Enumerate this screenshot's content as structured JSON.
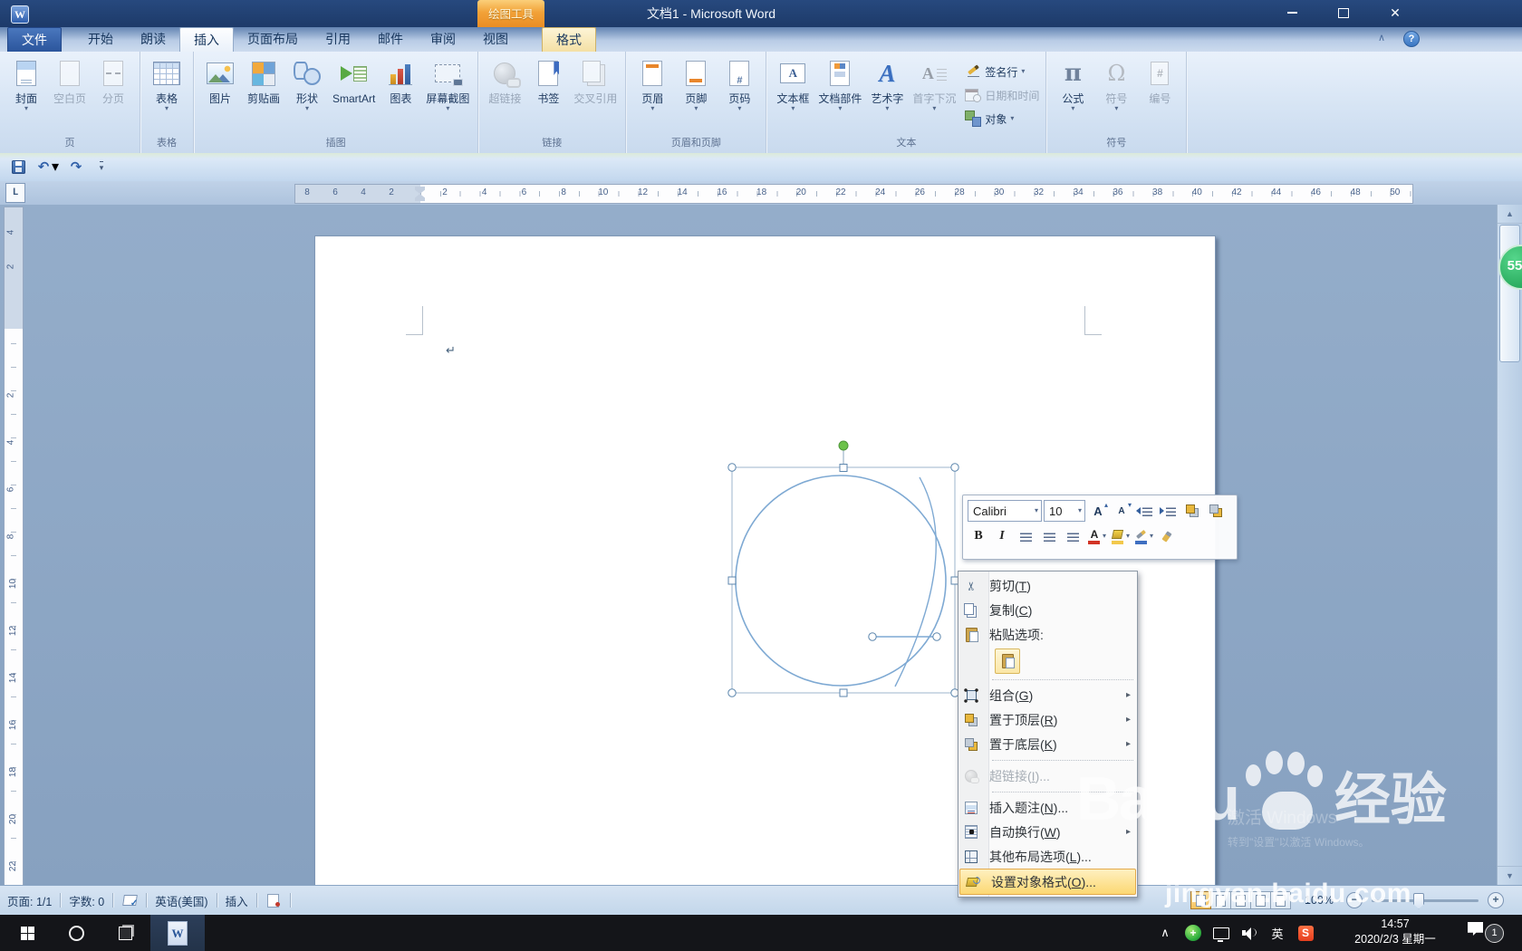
{
  "window": {
    "title": "文档1 - Microsoft Word",
    "app_icon": "W"
  },
  "drawing_tools": {
    "header": "绘图工具",
    "tab": "格式"
  },
  "tabs": [
    {
      "id": "file",
      "label": "文件",
      "type": "file"
    },
    {
      "id": "home",
      "label": "开始"
    },
    {
      "id": "read-aloud",
      "label": "朗读"
    },
    {
      "id": "insert",
      "label": "插入",
      "active": true
    },
    {
      "id": "page-layout",
      "label": "页面布局"
    },
    {
      "id": "references",
      "label": "引用"
    },
    {
      "id": "mailings",
      "label": "邮件"
    },
    {
      "id": "review",
      "label": "审阅"
    },
    {
      "id": "view",
      "label": "视图"
    }
  ],
  "ribbon": {
    "groups": [
      {
        "id": "pages",
        "label": "页",
        "buttons": [
          {
            "id": "cover-page",
            "label": "封面",
            "icon": "cover",
            "dropdown": true
          },
          {
            "id": "blank-page",
            "label": "空白页",
            "icon": "blankpage",
            "enabled": false
          },
          {
            "id": "page-break",
            "label": "分页",
            "icon": "pagebreak",
            "enabled": false
          }
        ]
      },
      {
        "id": "tables",
        "label": "表格",
        "buttons": [
          {
            "id": "table",
            "label": "表格",
            "icon": "table",
            "dropdown": true
          }
        ]
      },
      {
        "id": "illustrations",
        "label": "插图",
        "buttons": [
          {
            "id": "picture",
            "label": "图片",
            "icon": "picture"
          },
          {
            "id": "clip-art",
            "label": "剪贴画",
            "icon": "clipart"
          },
          {
            "id": "shapes",
            "label": "形状",
            "icon": "shapes",
            "dropdown": true
          },
          {
            "id": "smartart",
            "label": "SmartArt",
            "icon": "smartart"
          },
          {
            "id": "chart",
            "label": "图表",
            "icon": "chart"
          },
          {
            "id": "screenshot",
            "label": "屏幕截图",
            "icon": "screenshot",
            "dropdown": true
          }
        ]
      },
      {
        "id": "links",
        "label": "链接",
        "buttons": [
          {
            "id": "hyperlink",
            "label": "超链接",
            "icon": "hyperlink",
            "enabled": false
          },
          {
            "id": "bookmark",
            "label": "书签",
            "icon": "bookmark"
          },
          {
            "id": "cross-reference",
            "label": "交叉引用",
            "icon": "crossref",
            "enabled": false
          }
        ]
      },
      {
        "id": "header-footer",
        "label": "页眉和页脚",
        "buttons": [
          {
            "id": "header",
            "label": "页眉",
            "icon": "header",
            "dropdown": true
          },
          {
            "id": "footer",
            "label": "页脚",
            "icon": "footer",
            "dropdown": true
          },
          {
            "id": "page-number",
            "label": "页码",
            "icon": "pagenum",
            "dropdown": true
          }
        ]
      },
      {
        "id": "text",
        "label": "文本",
        "buttons": [
          {
            "id": "text-box",
            "label": "文本框",
            "icon": "textbox",
            "dropdown": true
          },
          {
            "id": "quick-parts",
            "label": "文档部件",
            "icon": "quickparts",
            "dropdown": true
          },
          {
            "id": "wordart",
            "label": "艺术字",
            "icon": "wordart",
            "dropdown": true
          },
          {
            "id": "drop-cap",
            "label": "首字下沉",
            "icon": "dropcap",
            "dropdown": true,
            "enabled": false
          }
        ],
        "small": [
          {
            "id": "signature-line",
            "label": "签名行",
            "icon": "signature",
            "dropdown": true
          },
          {
            "id": "date-time",
            "label": "日期和时间",
            "icon": "datetime",
            "enabled": false
          },
          {
            "id": "object",
            "label": "对象",
            "icon": "object",
            "dropdown": true
          }
        ]
      },
      {
        "id": "symbols",
        "label": "符号",
        "buttons": [
          {
            "id": "equation",
            "label": "公式",
            "icon": "equation",
            "dropdown": true
          },
          {
            "id": "symbol",
            "label": "符号",
            "icon": "symbol",
            "dropdown": true,
            "enabled": false
          },
          {
            "id": "number",
            "label": "编号",
            "icon": "numbering",
            "enabled": false
          }
        ]
      }
    ]
  },
  "qat": [
    {
      "id": "save",
      "icon": "save"
    },
    {
      "id": "undo",
      "icon": "undo",
      "dropdown": true
    },
    {
      "id": "redo",
      "icon": "redo"
    },
    {
      "id": "customize-qat",
      "icon": "qatmore"
    }
  ],
  "ruler": {
    "h_left_numbers": [
      8,
      6,
      4,
      2
    ],
    "h_numbers": [
      2,
      4,
      6,
      8,
      10,
      12,
      14,
      16,
      18,
      20,
      22,
      24,
      26,
      28,
      30,
      32,
      34,
      36,
      38,
      40,
      42,
      44,
      46,
      48,
      50
    ],
    "v_top_numbers": [
      4,
      2
    ],
    "v_numbers": [
      2,
      4,
      6,
      8,
      10,
      12,
      14,
      16,
      18,
      20,
      22
    ]
  },
  "page": {
    "pilcrow": "↵"
  },
  "mini_toolbar": {
    "font": "Calibri",
    "size": "10",
    "row1": [
      {
        "id": "grow-font",
        "icon": "grow"
      },
      {
        "id": "shrink-font",
        "icon": "shrink"
      },
      {
        "id": "decrease-indent",
        "icon": "outdent"
      },
      {
        "id": "increase-indent",
        "icon": "indent"
      },
      {
        "id": "bring-forward",
        "icon": "bringfront"
      },
      {
        "id": "send-backward",
        "icon": "sendback"
      }
    ],
    "row2": [
      {
        "id": "bold",
        "icon": "bold"
      },
      {
        "id": "italic",
        "icon": "italic"
      },
      {
        "id": "align-left",
        "icon": "alignl"
      },
      {
        "id": "align-center",
        "icon": "alignc"
      },
      {
        "id": "align-right",
        "icon": "alignr"
      },
      {
        "id": "font-color",
        "icon": "fontcolor",
        "dropdown": true
      },
      {
        "id": "shading",
        "icon": "shading",
        "dropdown": true
      },
      {
        "id": "outline-color",
        "icon": "outlinecolor",
        "dropdown": true
      },
      {
        "id": "format-painter",
        "icon": "painter"
      }
    ]
  },
  "context_menu": {
    "items": [
      {
        "id": "cut",
        "label": "剪切(T)",
        "icon": "cut"
      },
      {
        "id": "copy",
        "label": "复制(C)",
        "icon": "copy"
      },
      {
        "id": "paste-options",
        "label": "粘贴选项:",
        "icon": "paste"
      },
      {
        "id": "paste-keep-source-formatting",
        "type": "paste-btn",
        "icon": "paste"
      },
      {
        "type": "sep"
      },
      {
        "id": "group",
        "label": "组合(G)",
        "icon": "group",
        "submenu": true
      },
      {
        "id": "bring-to-front",
        "label": "置于顶层(R)",
        "icon": "bringfront",
        "submenu": true
      },
      {
        "id": "send-to-back",
        "label": "置于底层(K)",
        "icon": "sendback",
        "submenu": true
      },
      {
        "type": "sep"
      },
      {
        "id": "hyperlink",
        "label": "超链接(I)...",
        "icon": "hyperlink2",
        "disabled": true
      },
      {
        "type": "sep"
      },
      {
        "id": "insert-caption",
        "label": "插入题注(N)...",
        "icon": "caption"
      },
      {
        "id": "wrap-text",
        "label": "自动换行(W)",
        "icon": "wrap",
        "submenu": true
      },
      {
        "id": "more-layout-options",
        "label": "其他布局选项(L)...",
        "icon": "layoutopt"
      },
      {
        "id": "format-object",
        "label": "设置对象格式(O)...",
        "icon": "formatobj",
        "highlighted": true
      }
    ]
  },
  "status_bar": {
    "items": [
      {
        "id": "page-indicator",
        "label": "页面: 1/1"
      },
      {
        "id": "word-count",
        "label": "字数: 0"
      },
      {
        "id": "proofing",
        "icon": "proof"
      },
      {
        "id": "language",
        "label": "英语(美国)"
      },
      {
        "id": "insert-mode",
        "label": "插入"
      },
      {
        "id": "macro-record",
        "icon": "macro"
      }
    ],
    "views": [
      {
        "id": "print-layout",
        "active": true
      },
      {
        "id": "full-screen-reading"
      },
      {
        "id": "web-layout"
      },
      {
        "id": "outline"
      },
      {
        "id": "draft"
      }
    ],
    "zoom": "100%"
  },
  "taskbar": {
    "tray": [
      {
        "id": "tray-expand",
        "glyph": "∧",
        "kind": "glyph"
      },
      {
        "id": "tray-360-safety",
        "glyph": "+",
        "kind": "t360"
      },
      {
        "id": "tray-display",
        "kind": "tdisp"
      },
      {
        "id": "tray-volume",
        "kind": "tvol"
      },
      {
        "id": "tray-ime",
        "glyph": "英",
        "kind": "glyph"
      },
      {
        "id": "tray-sogou",
        "glyph": "S",
        "kind": "tsogou"
      }
    ],
    "time": "14:57",
    "date": "2020/2/3 星期一",
    "notification_count": "1"
  },
  "watermark": {
    "logo_text": "Baidu",
    "logo_suffix": "经验",
    "url": "jingyan.baidu.com",
    "activate": "激活 Windows",
    "activate_sub": "转到\"设置\"以激活 Windows。"
  },
  "badge55": "55"
}
